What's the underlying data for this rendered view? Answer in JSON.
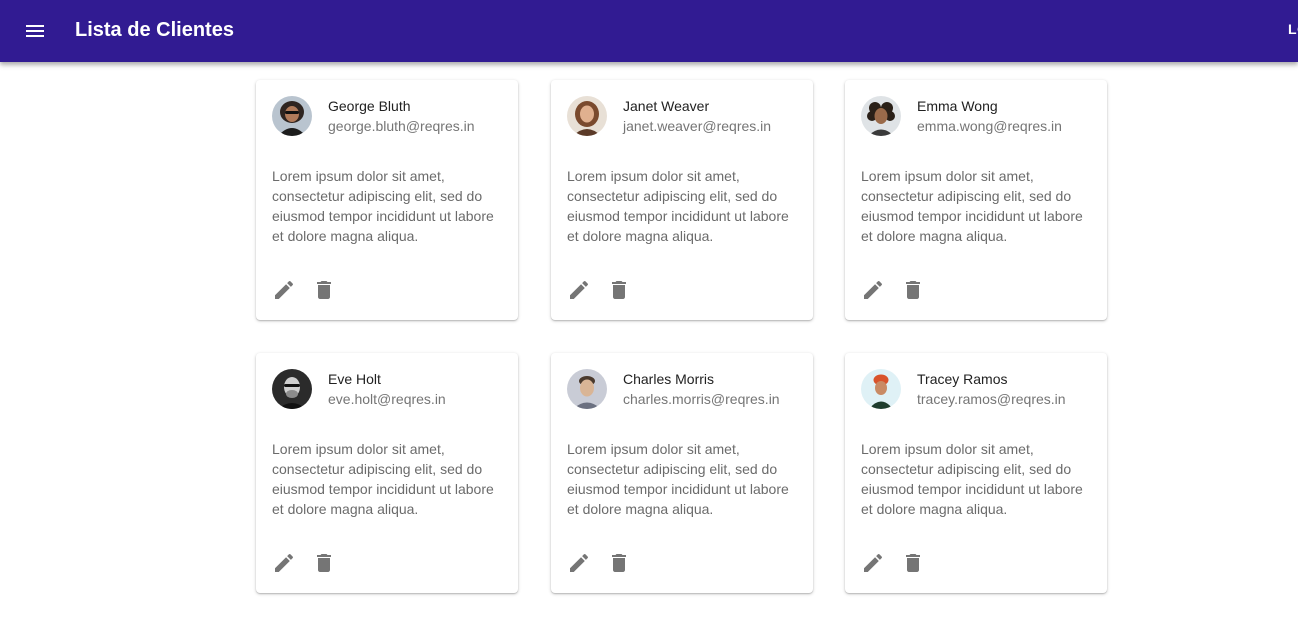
{
  "appbar": {
    "title": "Lista de Clientes",
    "login_label": "LOGIN",
    "menu_icon": "menu-icon",
    "background_color": "#311b92"
  },
  "cards": [
    {
      "name": "George Bluth",
      "email": "george.bluth@reqres.in",
      "text": "Lorem ipsum dolor sit amet, consectetur adipiscing elit, sed do eiusmod tempor incididunt ut labore et dolore magna aliqua.",
      "edit_icon": "pencil-icon",
      "delete_icon": "trash-icon"
    },
    {
      "name": "Janet Weaver",
      "email": "janet.weaver@reqres.in",
      "text": "Lorem ipsum dolor sit amet, consectetur adipiscing elit, sed do eiusmod tempor incididunt ut labore et dolore magna aliqua.",
      "edit_icon": "pencil-icon",
      "delete_icon": "trash-icon"
    },
    {
      "name": "Emma Wong",
      "email": "emma.wong@reqres.in",
      "text": "Lorem ipsum dolor sit amet, consectetur adipiscing elit, sed do eiusmod tempor incididunt ut labore et dolore magna aliqua.",
      "edit_icon": "pencil-icon",
      "delete_icon": "trash-icon"
    },
    {
      "name": "Eve Holt",
      "email": "eve.holt@reqres.in",
      "text": "Lorem ipsum dolor sit amet, consectetur adipiscing elit, sed do eiusmod tempor incididunt ut labore et dolore magna aliqua.",
      "edit_icon": "pencil-icon",
      "delete_icon": "trash-icon"
    },
    {
      "name": "Charles Morris",
      "email": "charles.morris@reqres.in",
      "text": "Lorem ipsum dolor sit amet, consectetur adipiscing elit, sed do eiusmod tempor incididunt ut labore et dolore magna aliqua.",
      "edit_icon": "pencil-icon",
      "delete_icon": "trash-icon"
    },
    {
      "name": "Tracey Ramos",
      "email": "tracey.ramos@reqres.in",
      "text": "Lorem ipsum dolor sit amet, consectetur adipiscing elit, sed do eiusmod tempor incididunt ut labore et dolore magna aliqua.",
      "edit_icon": "pencil-icon",
      "delete_icon": "trash-icon"
    }
  ]
}
